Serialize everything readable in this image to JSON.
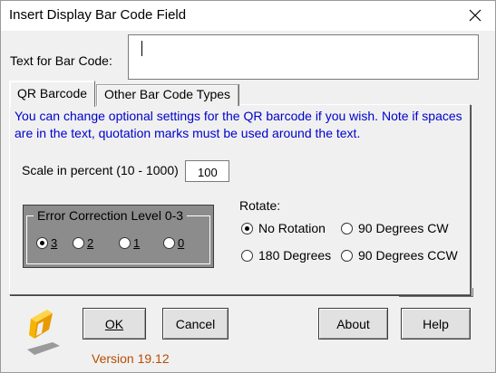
{
  "window": {
    "title": "Insert Display Bar Code Field"
  },
  "text_field": {
    "label": "Text for Bar Code:",
    "value": ""
  },
  "tabs": [
    {
      "label": "QR Barcode",
      "active": true
    },
    {
      "label": "Other Bar Code Types",
      "active": false
    }
  ],
  "panel": {
    "info": "You can change optional settings for the QR barcode if you wish. Note if spaces are in the text, quotation marks must be used around the text.",
    "scale_label": "Scale in percent (10 - 1000)",
    "scale_value": "100",
    "error_correction": {
      "title": "Error Correction Level 0-3",
      "options": [
        "3",
        "2",
        "1",
        "0"
      ],
      "selected": "3"
    },
    "rotate": {
      "label": "Rotate:",
      "options": [
        "No Rotation",
        "90 Degrees CW",
        "180 Degrees",
        "90 Degrees CCW"
      ],
      "selected": "No Rotation"
    }
  },
  "buttons": {
    "ok": "OK",
    "cancel": "Cancel",
    "about": "About",
    "help": "Help"
  },
  "version": "Version 19.12",
  "colors": {
    "info_text": "#0000cc",
    "version_text": "#b84d00",
    "logo": "#f5b400",
    "group_bg": "#8c8c8c"
  }
}
